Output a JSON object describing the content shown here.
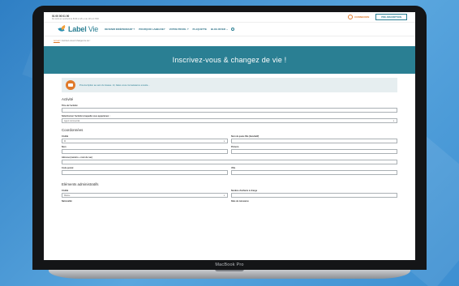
{
  "topbar": {
    "phone": "01 00 00 01 00",
    "subtext": "Du lundi au vendredi de 8h30 à 12h et de 14h à 17h30",
    "connexion": "CONNEXION",
    "preinscription": "PRÉ-INSCRIPTION"
  },
  "navbar": {
    "logo_label": "Label",
    "logo_vie": "Vie",
    "items": [
      "DEVENIR INDÉPENDANT ?",
      "POURQUOI LABELVIE?",
      "VOTRE PROFIL ?",
      "PLAQUETTE",
      "BLOG RIVER ⌄"
    ]
  },
  "breadcrumb": {
    "home": "Accueil",
    "current": "Inscrivez-vous & changez de vie !"
  },
  "hero": {
    "title": "Inscrivez-vous & changez de vie !"
  },
  "info_box": {
    "text": "Pré-inscription au sein du réseau. Ici, faites vous connaissance ensuite..."
  },
  "sections": {
    "activite": "Activité",
    "coordonnees": "Coordonnées",
    "elements_admin": "Eléments administratifs"
  },
  "fields": {
    "titre_activite": "Titre de l'activité",
    "selection_activite": "Sélectionner l'activité à laquelle vous appartenez :",
    "selection_value": "Agent commercial",
    "civilite": "Civilité",
    "civilite_value": "M.",
    "nom_jeune_fille": "Nom de jeune fille (facultatif)",
    "nom": "Nom",
    "prenom": "Prénom",
    "adresse": "Adresse (numéro + nom de rue)",
    "code_postal": "Code postal",
    "ville": "Ville",
    "civilite2": "Civilité",
    "civilite2_value": "Mariée",
    "nombre_enfants": "Nombre d'enfants à charge",
    "nationalite": "Nationalité",
    "date_naissance": "Date de naissance"
  },
  "laptop": {
    "label": "MacBook Pro"
  },
  "colors": {
    "brand_teal": "#2a7f93",
    "accent_orange": "#e07a2b"
  }
}
